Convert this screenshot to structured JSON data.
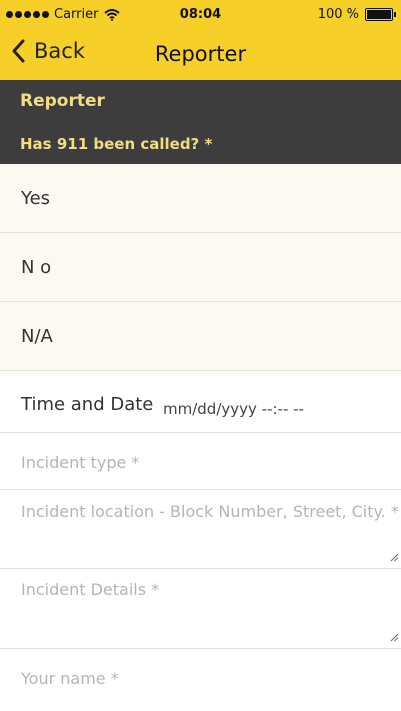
{
  "status_bar": {
    "carrier": "Carrier",
    "time": "08:04",
    "battery": "100 %"
  },
  "nav": {
    "back_label": "Back",
    "title": "Reporter"
  },
  "section": {
    "title": "Reporter",
    "question": "Has 911 been called? *"
  },
  "options": [
    "Yes",
    "N o",
    "N/A"
  ],
  "datetime": {
    "label": "Time and Date",
    "placeholder": "mm/dd/yyyy  --:--  --"
  },
  "fields": {
    "incident_type": "Incident type *",
    "incident_location": "Incident location - Block Number, Street, City. *",
    "incident_details": "Incident Details *",
    "your_name": "Your name *"
  },
  "colors": {
    "accent": "#f7cf29",
    "header_bg": "#3d3d3d",
    "header_text": "#f2dc84"
  }
}
